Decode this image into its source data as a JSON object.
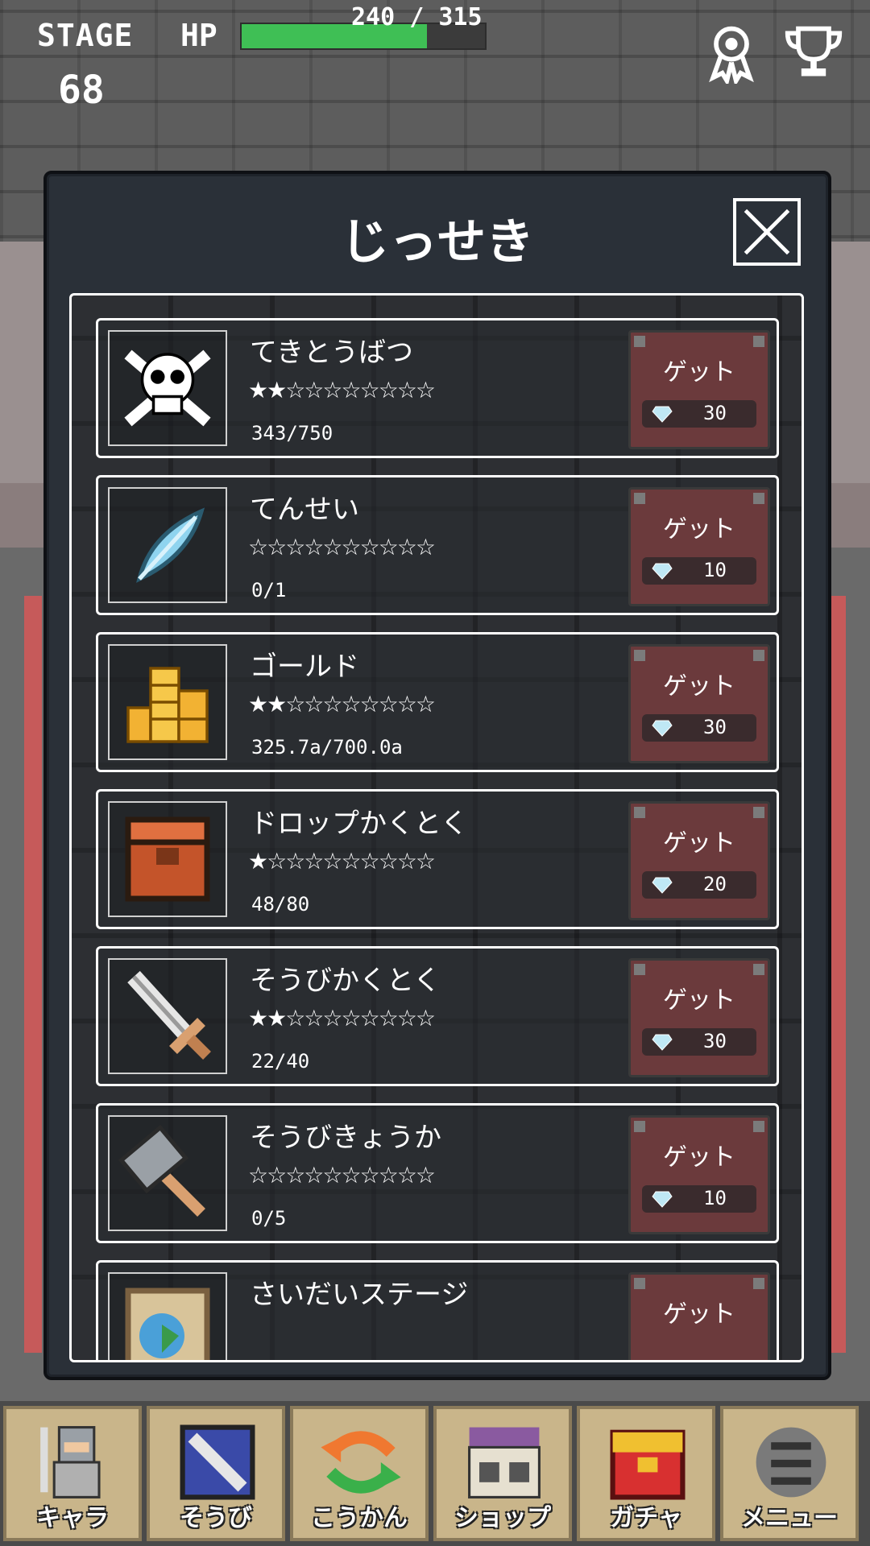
{
  "hud": {
    "stage_label": "STAGE",
    "stage_value": "68",
    "hp_label": "HP",
    "hp_text": "240 / 315",
    "hp_fraction": 0.762
  },
  "modal": {
    "title": "じっせき"
  },
  "achievements": [
    {
      "name": "てきとうばつ",
      "stars": "★★☆☆☆☆☆☆☆☆",
      "progress": "343/750",
      "get_label": "ゲット",
      "cost": "30",
      "icon": "skull-icon"
    },
    {
      "name": "てんせい",
      "stars": "☆☆☆☆☆☆☆☆☆☆",
      "progress": "0/1",
      "get_label": "ゲット",
      "cost": "10",
      "icon": "feather-icon"
    },
    {
      "name": "ゴールド",
      "stars": "★★☆☆☆☆☆☆☆☆",
      "progress": "325.7a/700.0a",
      "get_label": "ゲット",
      "cost": "30",
      "icon": "gold-coins-icon"
    },
    {
      "name": "ドロップかくとく",
      "stars": "★☆☆☆☆☆☆☆☆☆",
      "progress": "48/80",
      "get_label": "ゲット",
      "cost": "20",
      "icon": "treasure-chest-icon"
    },
    {
      "name": "そうびかくとく",
      "stars": "★★☆☆☆☆☆☆☆☆",
      "progress": "22/40",
      "get_label": "ゲット",
      "cost": "30",
      "icon": "sword-icon"
    },
    {
      "name": "そうびきょうか",
      "stars": "☆☆☆☆☆☆☆☆☆☆",
      "progress": "0/5",
      "get_label": "ゲット",
      "cost": "10",
      "icon": "hammer-icon"
    },
    {
      "name": "さいだいステージ",
      "stars": "",
      "progress": "",
      "get_label": "ゲット",
      "cost": "",
      "icon": "map-icon"
    }
  ],
  "nav": [
    {
      "label": "キャラ",
      "icon": "knight-icon"
    },
    {
      "label": "そうび",
      "icon": "equipment-icon"
    },
    {
      "label": "こうかん",
      "icon": "exchange-icon"
    },
    {
      "label": "ショップ",
      "icon": "shop-icon"
    },
    {
      "label": "ガチャ",
      "icon": "gacha-chest-icon"
    },
    {
      "label": "メニュー",
      "icon": "menu-icon"
    }
  ],
  "colors": {
    "hp_fill": "#3fbf55",
    "get_button": "#6b3a3c",
    "modal_bg": "#2a3038"
  }
}
